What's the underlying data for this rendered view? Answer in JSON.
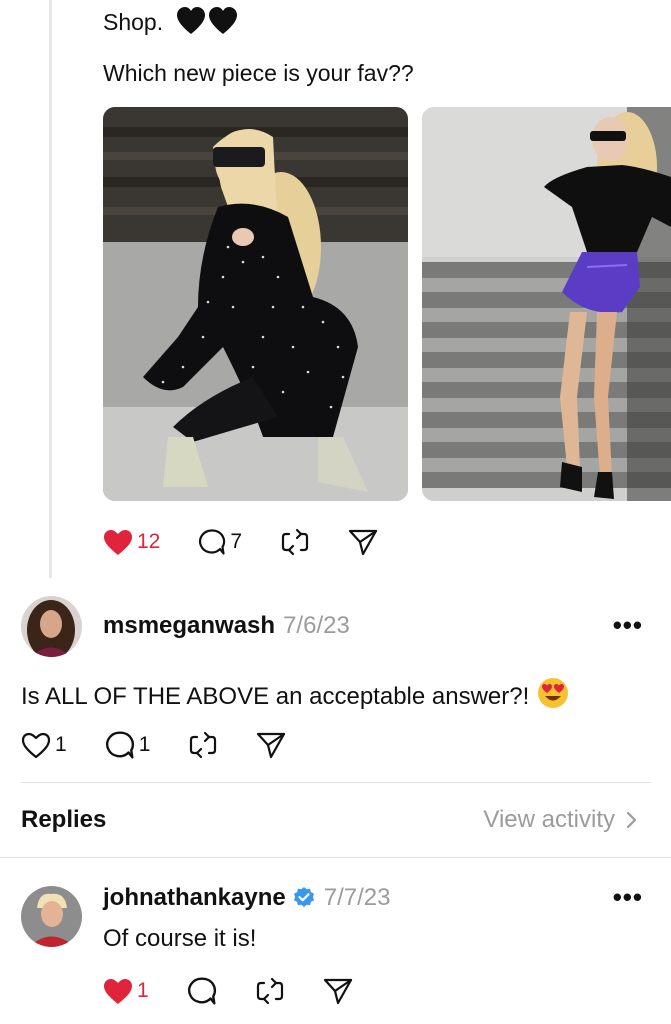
{
  "post": {
    "line1": "Shop.",
    "line2": "Which new piece is your fav??",
    "likes": "12",
    "comments": "7"
  },
  "comment": {
    "username": "msmeganwash",
    "date": "7/6/23",
    "text": "Is ALL OF THE ABOVE an acceptable answer?!",
    "emoji": "😍",
    "likes": "1",
    "comments": "1",
    "more": "•••"
  },
  "replies_section": {
    "title": "Replies",
    "link": "View activity"
  },
  "reply": {
    "username": "johnathankayne",
    "date": "7/7/23",
    "text": "Of course it is!",
    "likes": "1",
    "more": "•••",
    "verified": true
  },
  "colors": {
    "like_red": "#e0243b",
    "verified_blue": "#3897f0",
    "muted_gray": "#9b9b9b"
  },
  "icons": [
    "heart-icon",
    "comment-icon",
    "repost-icon",
    "share-icon",
    "more-icon",
    "verified-icon",
    "chevron-right-icon"
  ]
}
